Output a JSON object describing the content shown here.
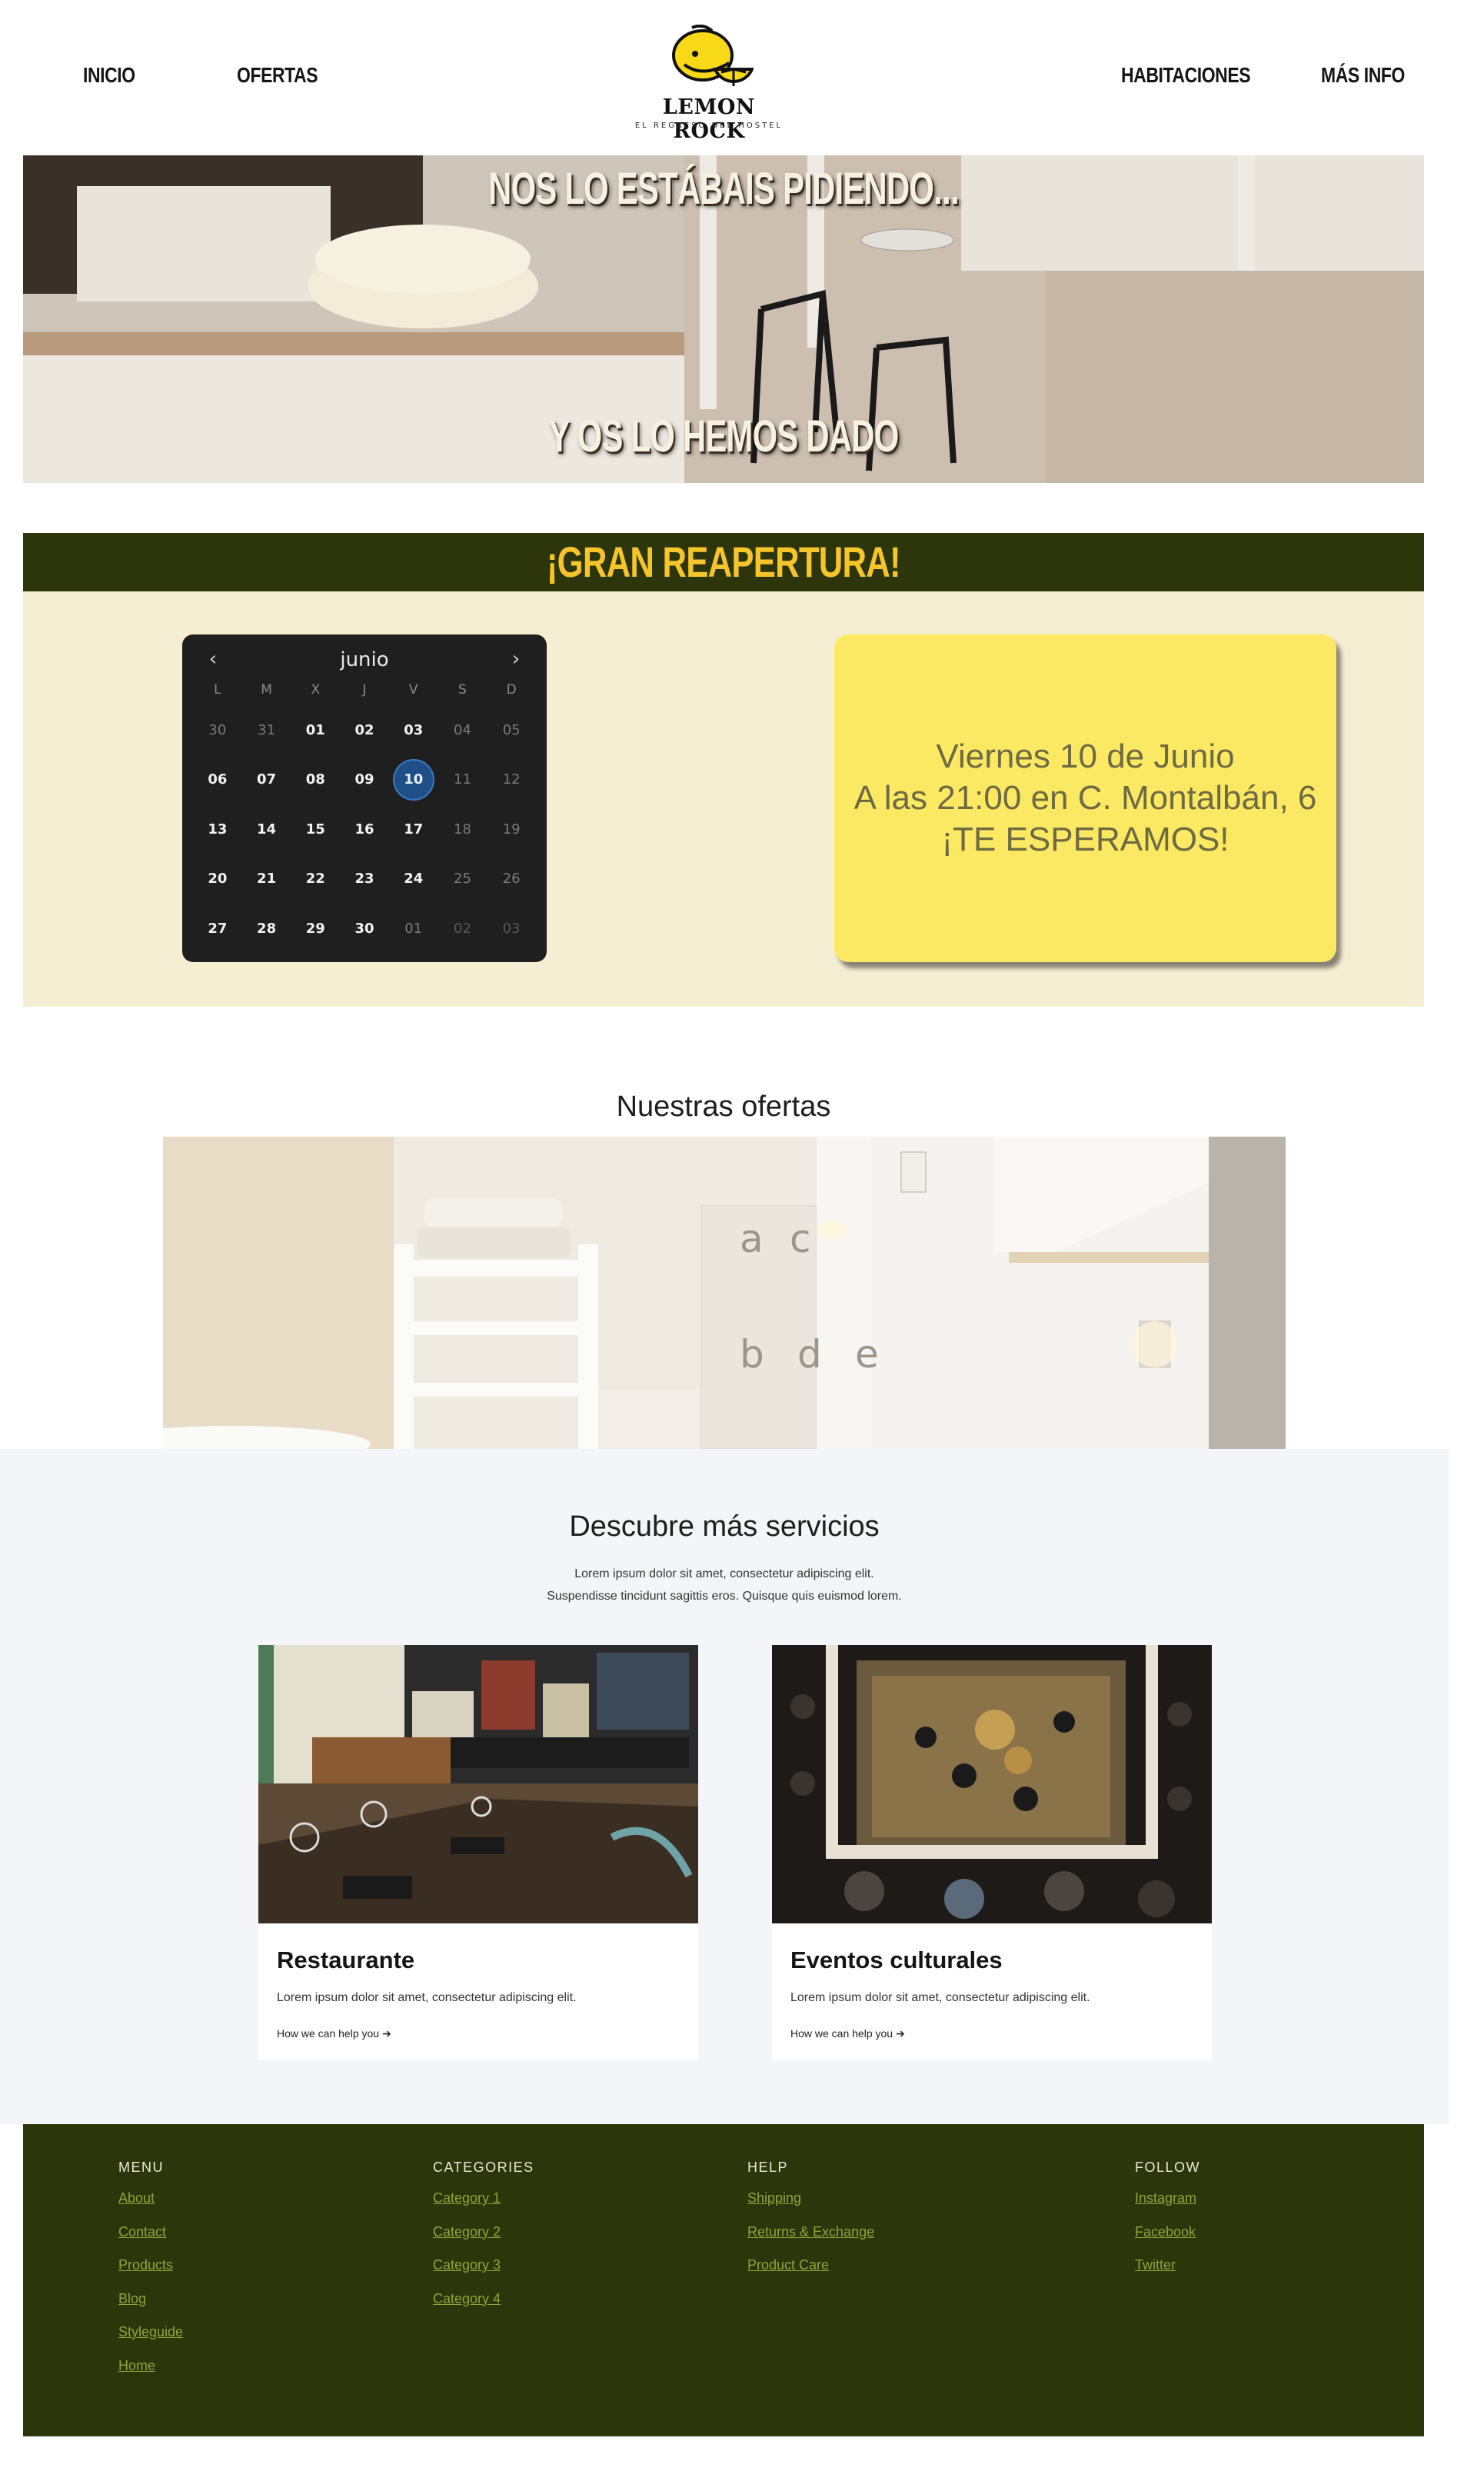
{
  "nav": {
    "left": [
      "INICIO",
      "OFERTAS"
    ],
    "right": [
      "HABITACIONES",
      "MÁS INFO"
    ]
  },
  "logo": {
    "name": "LEMON ROCK",
    "tagline": "EL REGRESO DEL HOSTEL"
  },
  "hero": {
    "top_text": "NOS LO ESTÁBAIS PIDIENDO...",
    "bottom_text": "Y OS LO HEMOS DADO"
  },
  "reopening": {
    "title": "¡GRAN REAPERTURA!",
    "calendar": {
      "month": "junio",
      "prev_icon": "chevron-left-icon",
      "next_icon": "chevron-right-icon",
      "weekdays": [
        "L",
        "M",
        "X",
        "J",
        "V",
        "S",
        "D"
      ],
      "weeks": [
        [
          "30",
          "31",
          "01",
          "02",
          "03",
          "04",
          "05"
        ],
        [
          "06",
          "07",
          "08",
          "09",
          "10",
          "11",
          "12"
        ],
        [
          "13",
          "14",
          "15",
          "16",
          "17",
          "18",
          "19"
        ],
        [
          "20",
          "21",
          "22",
          "23",
          "24",
          "25",
          "26"
        ],
        [
          "27",
          "28",
          "29",
          "30",
          "01",
          "02",
          "03"
        ]
      ],
      "selected": "10"
    },
    "event": {
      "line1": "Viernes 10 de Junio",
      "line2": "A las 21:00 en C. Montalbán, 6",
      "line3": "¡TE ESPERAMOS!"
    }
  },
  "offers": {
    "title": "Nuestras ofertas"
  },
  "services": {
    "title": "Descubre más servicios",
    "subtitle_line1": "Lorem ipsum dolor sit amet, consectetur adipiscing elit.",
    "subtitle_line2": "Suspendisse tincidunt sagittis eros. Quisque quis euismod lorem.",
    "cards": [
      {
        "title": "Restaurante",
        "desc": "Lorem ipsum dolor sit amet, consectetur adipiscing elit.",
        "link": "How we can help you ➔"
      },
      {
        "title": "Eventos culturales",
        "desc": "Lorem ipsum dolor sit amet, consectetur adipiscing elit.",
        "link": "How we can help you ➔"
      }
    ]
  },
  "footer": {
    "menu": {
      "heading": "MENU",
      "links": [
        "About",
        "Contact",
        "Products",
        "Blog",
        "Styleguide",
        "Home"
      ]
    },
    "categories": {
      "heading": "CATEGORIES",
      "links": [
        "Category 1",
        "Category 2",
        "Category 3",
        "Category 4"
      ]
    },
    "help": {
      "heading": "HELP",
      "links": [
        "Shipping",
        "Returns & Exchange",
        "Product Care"
      ]
    },
    "follow": {
      "heading": "FOLLOW",
      "links": [
        "Instagram",
        "Facebook",
        "Twitter"
      ]
    }
  },
  "colors": {
    "dark_olive": "#2d350b",
    "gold": "#f5c52b",
    "cream": "#f6eed3",
    "yellow_card": "#fbe963",
    "footer_link": "#8fa43a"
  }
}
